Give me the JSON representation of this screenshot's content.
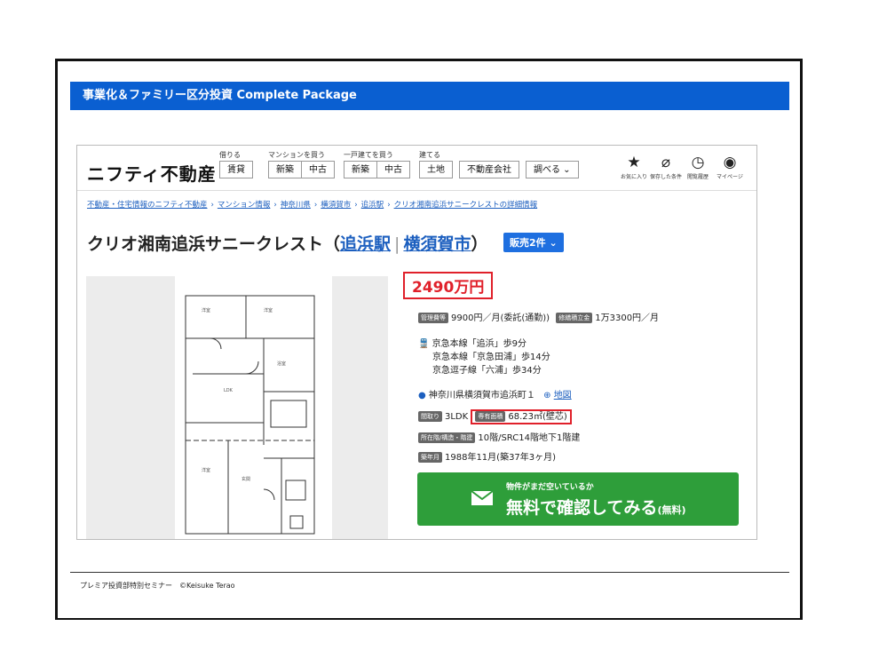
{
  "banner": {
    "title": "事業化＆ファミリー区分投資 Complete Package"
  },
  "site": {
    "logo": "ニフティ不動産",
    "nav": [
      {
        "caption": "借りる",
        "buttons": [
          "賃貸"
        ]
      },
      {
        "caption": "マンションを買う",
        "buttons": [
          "新築",
          "中古"
        ]
      },
      {
        "caption": "一戸建てを買う",
        "buttons": [
          "新築",
          "中古"
        ]
      },
      {
        "caption": "建てる",
        "buttons": [
          "土地",
          "不動産会社",
          "調べる ⌄"
        ]
      }
    ],
    "icons": [
      {
        "name": "star-icon",
        "glyph": "★",
        "label": "お気に入り"
      },
      {
        "name": "paperclip-icon",
        "glyph": "⌀",
        "label": "保存した条件"
      },
      {
        "name": "history-icon",
        "glyph": "◷",
        "label": "閲覧履歴"
      },
      {
        "name": "user-icon",
        "glyph": "◉",
        "label": "マイページ"
      }
    ]
  },
  "breadcrumb": [
    "不動産・住宅情報のニフティ不動産",
    "マンション情報",
    "神奈川県",
    "横須賀市",
    "追浜駅",
    "クリオ湘南追浜サニークレストの詳細情報"
  ],
  "property": {
    "name": "クリオ湘南追浜サニークレスト（",
    "station": "追浜駅",
    "city": "横須賀市",
    "close": "）",
    "sale_badge": "販売2件 ⌄",
    "price": "2490万円",
    "mgmt_label": "管理費等",
    "mgmt_value": "9900円／月(委託(通勤))",
    "repair_label": "修繕積立金",
    "repair_value": "1万3300円／月",
    "access": [
      "京急本線「追浜」歩9分",
      "京急本線「京急田浦」歩14分",
      "京急逗子線「六浦」歩34分"
    ],
    "address": "神奈川県横須賀市追浜町１",
    "map_link": "地図",
    "layout_label": "間取り",
    "layout_value": "3LDK",
    "area_label": "専有面積",
    "area_value": "68.23㎡(壁芯)",
    "floor_label": "所在階/構造・階建",
    "floor_value": "10階/SRC14階地下1階建",
    "built_label": "築年月",
    "built_value": "1988年11月(築37年3ヶ月)"
  },
  "cta": {
    "small": "物件がまだ空いているか",
    "big": "無料で確認してみる",
    "suffix": "(無料)"
  },
  "footer": {
    "text": "プレミア投資部特別セミナー　©Keisuke Terao"
  },
  "colors": {
    "banner": "#0a5fd1",
    "accent_red": "#e0202a",
    "cta_green": "#2e9e3a",
    "link": "#1c5fbf"
  }
}
